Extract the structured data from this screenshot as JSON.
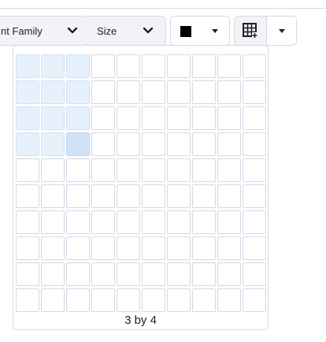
{
  "toolbar": {
    "font_family": {
      "label": "nt Family",
      "icon": "chevron-down-icon"
    },
    "font_size": {
      "label": "Size",
      "icon": "chevron-down-icon"
    },
    "text_color": {
      "swatch_color": "#000000",
      "icon": "caret-down-icon"
    },
    "insert_table": {
      "icon": "table-grid-icon",
      "caret_icon": "caret-down-icon"
    }
  },
  "table_picker": {
    "rows": 10,
    "columns": 10,
    "selected_columns": 3,
    "selected_rows": 4,
    "size_label": "3 by 4"
  },
  "colors": {
    "border": "#d3d9e3",
    "selected_cell": "#e6f1fc",
    "focused_cell": "#d0e4f8",
    "text": "#202122"
  }
}
